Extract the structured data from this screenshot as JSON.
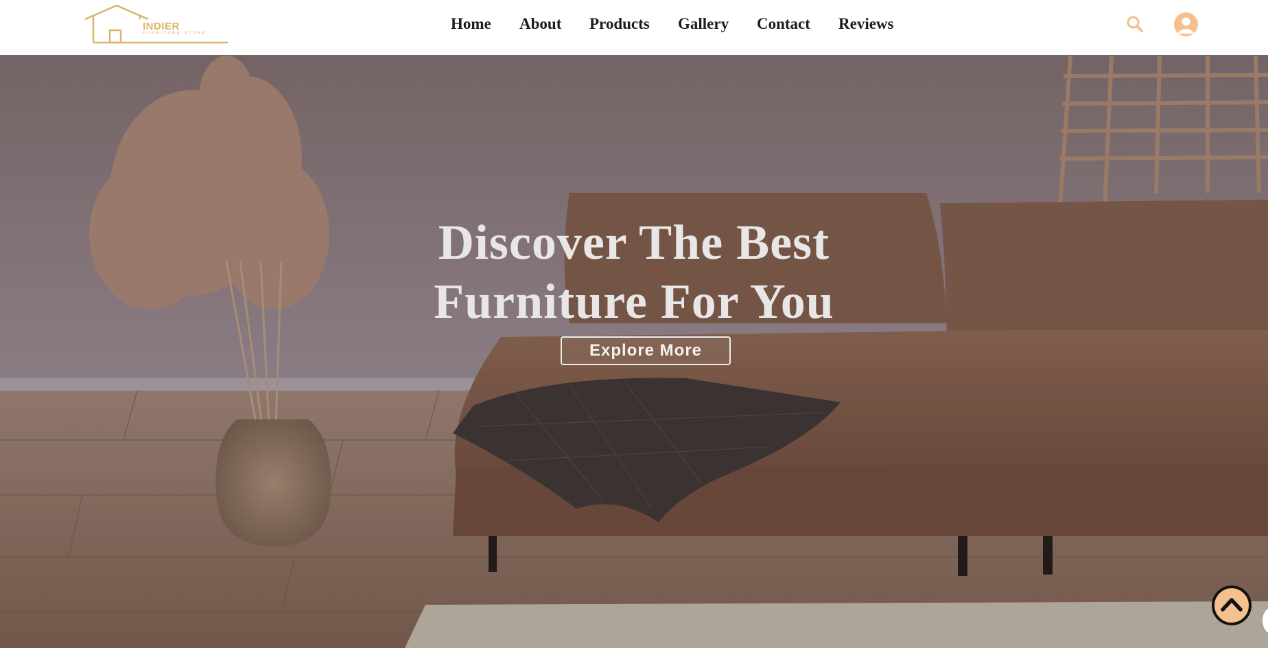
{
  "brand": {
    "name": "INDIER",
    "tagline": "FURNITURE STORE",
    "color": "#d9b46a"
  },
  "nav": {
    "items": [
      {
        "label": "Home"
      },
      {
        "label": "About"
      },
      {
        "label": "Products"
      },
      {
        "label": "Gallery"
      },
      {
        "label": "Contact"
      },
      {
        "label": "Reviews"
      }
    ]
  },
  "header_icons": {
    "search": "search-icon",
    "account": "user-icon",
    "accent": "#f4c08e"
  },
  "hero": {
    "title_line1": "Discover The Best",
    "title_line2": "Furniture For You",
    "cta_label": "Explore More"
  },
  "scroll_top": {
    "icon": "chevron-up-icon"
  }
}
